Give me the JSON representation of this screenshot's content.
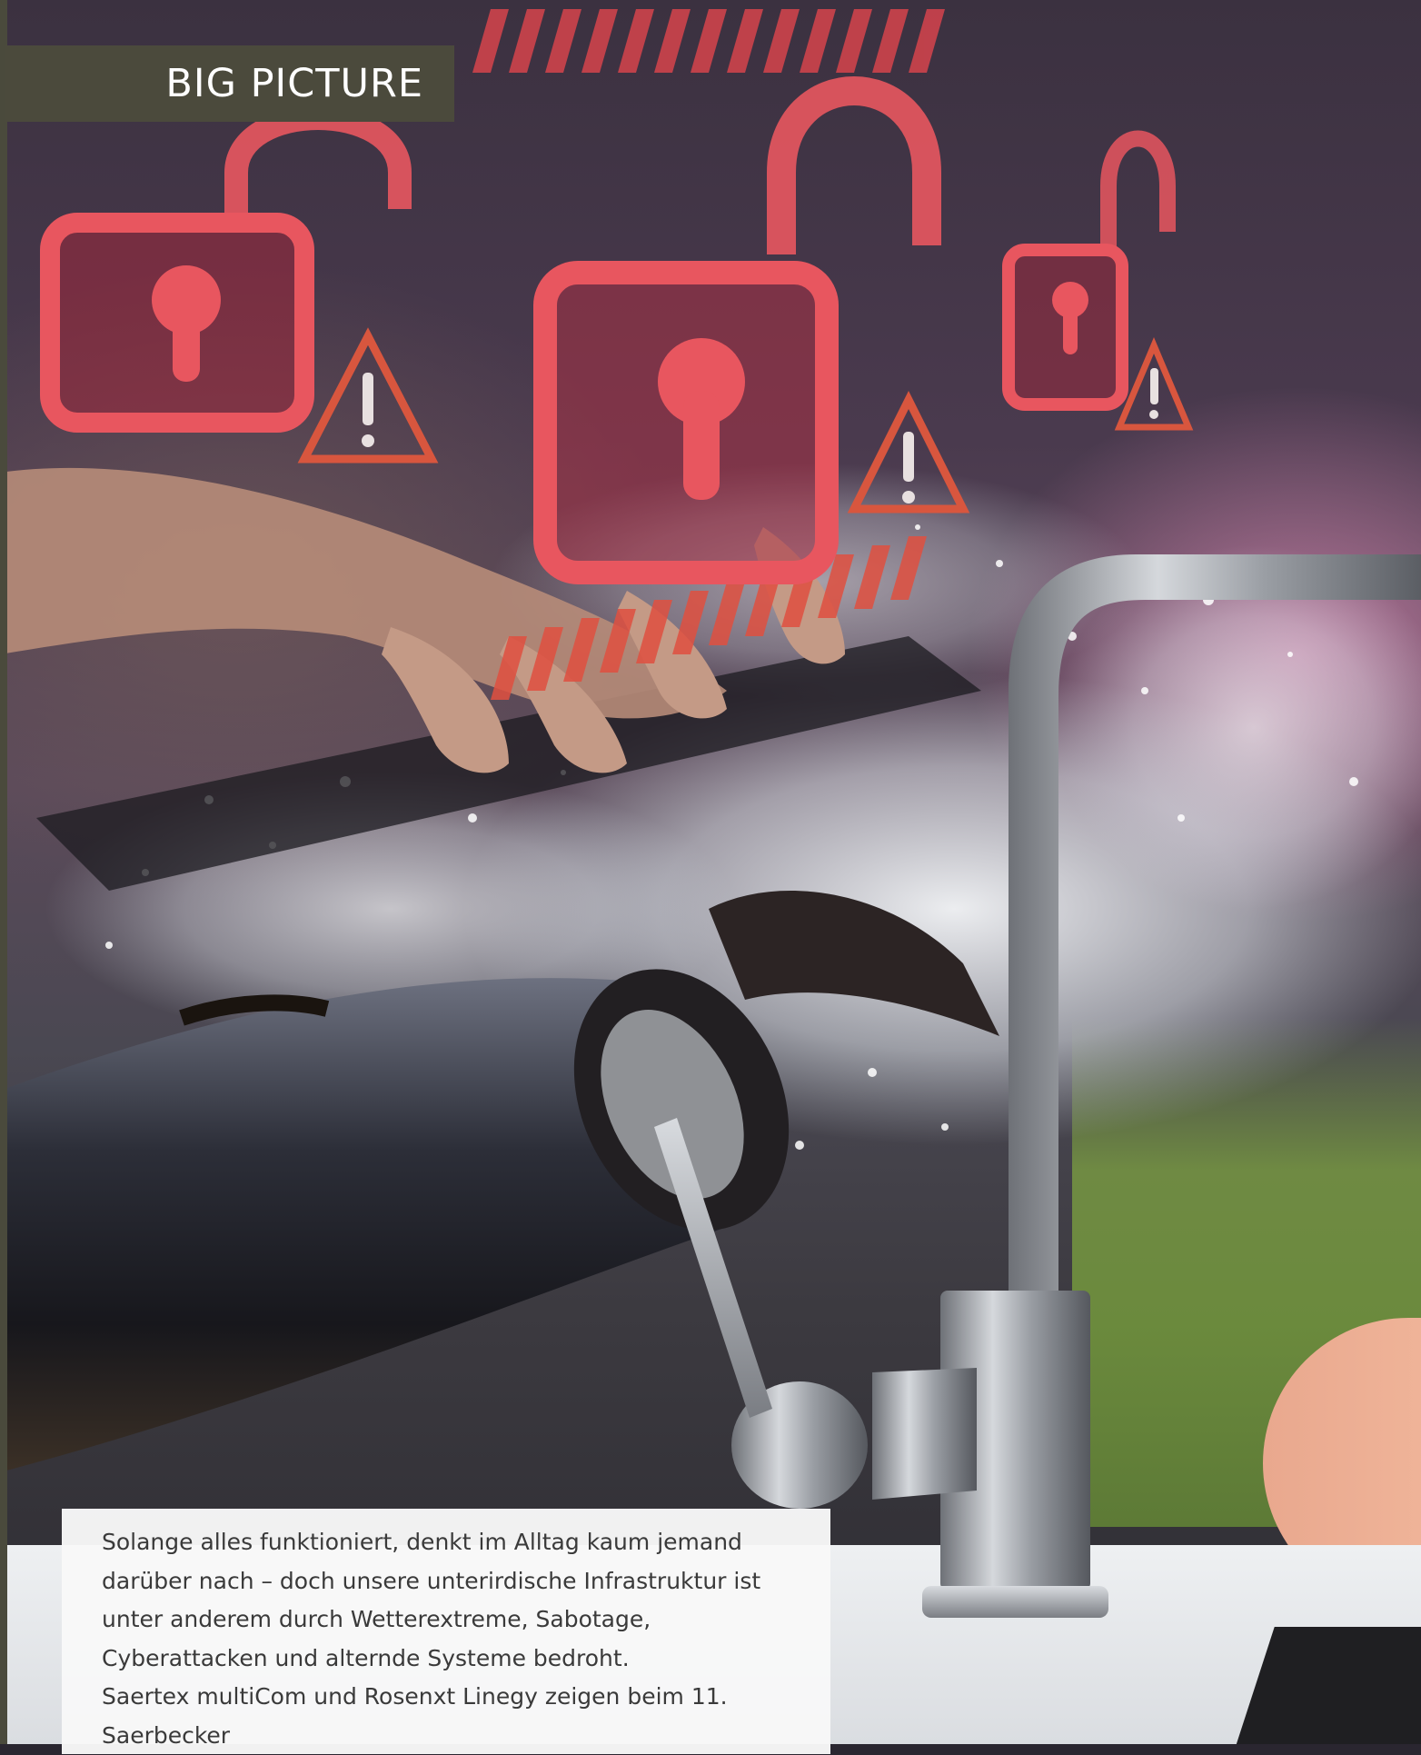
{
  "section_label": "BIG PICTURE",
  "intro_text": {
    "paragraph_1": "Solange alles funktioniert, denkt im Alltag kaum jemand darüber nach – doch unsere unterirdische Infrastruktur ist unter anderem durch Wetterextreme, Sabotage, Cyberattacken und alternde Systeme bedroht.",
    "paragraph_2": "Saertex multiCom und Rosenxt Linegy zeigen beim 11. Saerbecker"
  },
  "colors": {
    "label_background": "#4b4a3c",
    "lock_red": "#e8565f",
    "warning_orange": "#d8563e",
    "text": "#3a3a3a"
  },
  "icons": [
    "padlock-open-icon",
    "warning-triangle-icon",
    "hazard-stripes"
  ]
}
